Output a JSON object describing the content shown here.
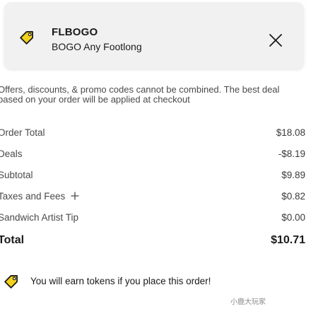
{
  "promo": {
    "code": "FLBOGO",
    "description": "BOGO Any Footlong"
  },
  "notice": "Offers, discounts, & promo codes cannot be combined. The best deal based on your order will be applied at checkout",
  "summary": [
    {
      "label": "Order Total",
      "value": "$18.08"
    },
    {
      "label": "Deals",
      "value": "-$8.19"
    },
    {
      "label": "Subtotal",
      "value": "$9.89"
    },
    {
      "label": "Taxes and Fees",
      "value": "$0.82"
    },
    {
      "label": "Sandwich Artist Tip",
      "value": "$0.00"
    }
  ],
  "total": {
    "label": "Total",
    "value": "$10.71"
  },
  "tokens_message": "You will earn tokens if you place this order!",
  "watermark": "小鹿大玩家",
  "colors": {
    "card_background": "#f1f1f1",
    "icon_yellow": "#f2d21a",
    "text_primary": "#1a1a1a",
    "text_secondary": "#4a4a4a"
  }
}
